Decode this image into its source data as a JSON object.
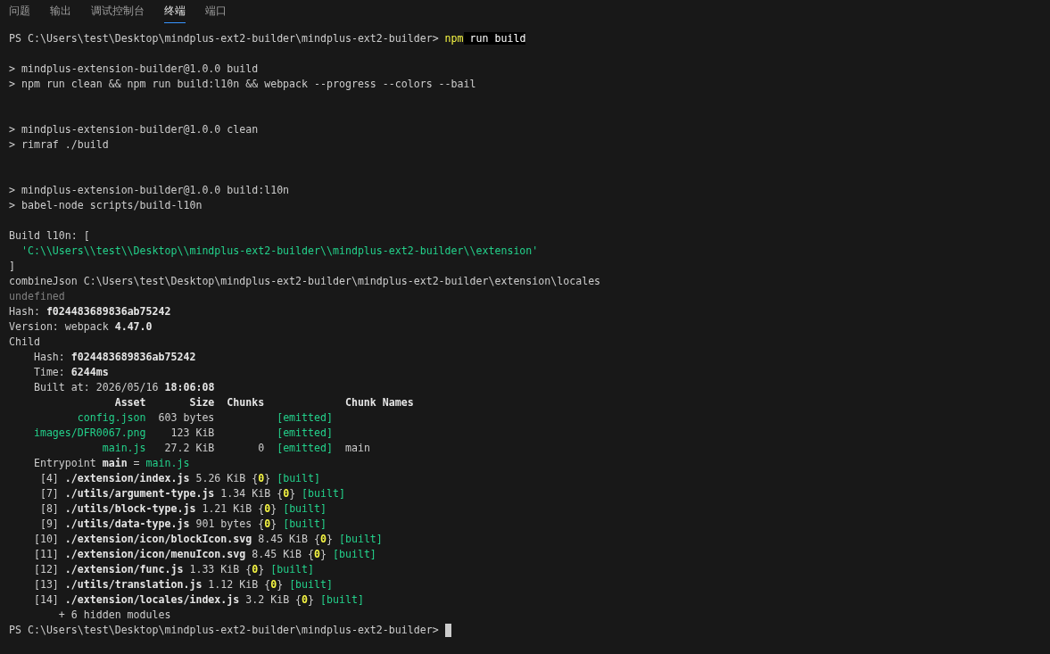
{
  "panel_tabs": [
    {
      "label": "问题",
      "selected": false
    },
    {
      "label": "输出",
      "selected": false
    },
    {
      "label": "调试控制台",
      "selected": false
    },
    {
      "label": "终端",
      "selected": true
    },
    {
      "label": "端口",
      "selected": false
    }
  ],
  "terminal_lines": [
    {
      "kind": "text",
      "segments": [
        {
          "kind": "plain",
          "text": "PS C:\\Users\\test\\Desktop\\mindplus-ext2-builder\\mindplus-ext2-builder> "
        },
        {
          "kind": "command",
          "text": "npm"
        },
        {
          "kind": "highlight",
          "text": " run build"
        }
      ]
    },
    {
      "kind": "blank"
    },
    {
      "kind": "text",
      "segments": [
        {
          "kind": "plain",
          "text": "> mindplus-extension-builder@1.0.0 build"
        }
      ]
    },
    {
      "kind": "text",
      "segments": [
        {
          "kind": "plain",
          "text": "> npm run clean && npm run build:l10n && webpack --progress --colors --bail"
        }
      ]
    },
    {
      "kind": "blank"
    },
    {
      "kind": "blank"
    },
    {
      "kind": "text",
      "segments": [
        {
          "kind": "plain",
          "text": "> mindplus-extension-builder@1.0.0 clean"
        }
      ]
    },
    {
      "kind": "text",
      "segments": [
        {
          "kind": "plain",
          "text": "> rimraf ./build"
        }
      ]
    },
    {
      "kind": "blank"
    },
    {
      "kind": "blank"
    },
    {
      "kind": "text",
      "segments": [
        {
          "kind": "plain",
          "text": "> mindplus-extension-builder@1.0.0 build:l10n"
        }
      ]
    },
    {
      "kind": "text",
      "segments": [
        {
          "kind": "plain",
          "text": "> babel-node scripts/build-l10n"
        }
      ]
    },
    {
      "kind": "blank"
    },
    {
      "kind": "text",
      "segments": [
        {
          "kind": "plain",
          "text": "Build l10n: ["
        }
      ]
    },
    {
      "kind": "text",
      "segments": [
        {
          "kind": "green",
          "text": "  'C:\\\\Users\\\\test\\\\Desktop\\\\mindplus-ext2-builder\\\\mindplus-ext2-builder\\\\extension'"
        }
      ]
    },
    {
      "kind": "text",
      "segments": [
        {
          "kind": "plain",
          "text": "]"
        }
      ]
    },
    {
      "kind": "text",
      "segments": [
        {
          "kind": "plain",
          "text": "combineJson C:\\Users\\test\\Desktop\\mindplus-ext2-builder\\mindplus-ext2-builder\\extension\\locales"
        }
      ]
    },
    {
      "kind": "text",
      "segments": [
        {
          "kind": "dim",
          "text": "undefined"
        }
      ]
    },
    {
      "kind": "text",
      "segments": [
        {
          "kind": "plain",
          "text": "Hash: "
        },
        {
          "kind": "bold",
          "text": "f024483689836ab75242"
        }
      ]
    },
    {
      "kind": "text",
      "segments": [
        {
          "kind": "plain",
          "text": "Version: webpack "
        },
        {
          "kind": "bold",
          "text": "4.47.0"
        }
      ]
    },
    {
      "kind": "text",
      "segments": [
        {
          "kind": "plain",
          "text": "Child"
        }
      ]
    },
    {
      "kind": "text",
      "segments": [
        {
          "kind": "plain",
          "text": "    Hash: "
        },
        {
          "kind": "bold",
          "text": "f024483689836ab75242"
        }
      ]
    },
    {
      "kind": "text",
      "segments": [
        {
          "kind": "plain",
          "text": "    Time: "
        },
        {
          "kind": "bold",
          "text": "6244ms"
        }
      ]
    },
    {
      "kind": "text",
      "segments": [
        {
          "kind": "plain",
          "text": "    Built at: 2026/05/16 "
        },
        {
          "kind": "bold",
          "text": "18:06:08"
        }
      ]
    },
    {
      "kind": "text",
      "segments": [
        {
          "kind": "bold",
          "text": "                 Asset       Size  Chunks             Chunk Names"
        }
      ]
    },
    {
      "kind": "text",
      "segments": [
        {
          "kind": "green",
          "text": "           config.json"
        },
        {
          "kind": "plain",
          "text": "  603 bytes          "
        },
        {
          "kind": "green",
          "text": "[emitted]"
        }
      ]
    },
    {
      "kind": "text",
      "segments": [
        {
          "kind": "green",
          "text": "    images/DFR0067.png"
        },
        {
          "kind": "plain",
          "text": "    123 KiB          "
        },
        {
          "kind": "green",
          "text": "[emitted]"
        }
      ]
    },
    {
      "kind": "text",
      "segments": [
        {
          "kind": "green",
          "text": "               main.js"
        },
        {
          "kind": "plain",
          "text": "   27.2 KiB       0  "
        },
        {
          "kind": "green",
          "text": "[emitted]"
        },
        {
          "kind": "plain",
          "text": "  main"
        }
      ]
    },
    {
      "kind": "text",
      "segments": [
        {
          "kind": "plain",
          "text": "    Entrypoint "
        },
        {
          "kind": "bold",
          "text": "main"
        },
        {
          "kind": "plain",
          "text": " = "
        },
        {
          "kind": "green",
          "text": "main.js"
        }
      ]
    },
    {
      "kind": "text",
      "segments": [
        {
          "kind": "plain",
          "text": "     [4] "
        },
        {
          "kind": "bold",
          "text": "./extension/index.js"
        },
        {
          "kind": "plain",
          "text": " 5.26 KiB {"
        },
        {
          "kind": "yellow",
          "text": "0"
        },
        {
          "kind": "plain",
          "text": "} "
        },
        {
          "kind": "green",
          "text": "[built]"
        }
      ]
    },
    {
      "kind": "text",
      "segments": [
        {
          "kind": "plain",
          "text": "     [7] "
        },
        {
          "kind": "bold",
          "text": "./utils/argument-type.js"
        },
        {
          "kind": "plain",
          "text": " 1.34 KiB {"
        },
        {
          "kind": "yellow",
          "text": "0"
        },
        {
          "kind": "plain",
          "text": "} "
        },
        {
          "kind": "green",
          "text": "[built]"
        }
      ]
    },
    {
      "kind": "text",
      "segments": [
        {
          "kind": "plain",
          "text": "     [8] "
        },
        {
          "kind": "bold",
          "text": "./utils/block-type.js"
        },
        {
          "kind": "plain",
          "text": " 1.21 KiB {"
        },
        {
          "kind": "yellow",
          "text": "0"
        },
        {
          "kind": "plain",
          "text": "} "
        },
        {
          "kind": "green",
          "text": "[built]"
        }
      ]
    },
    {
      "kind": "text",
      "segments": [
        {
          "kind": "plain",
          "text": "     [9] "
        },
        {
          "kind": "bold",
          "text": "./utils/data-type.js"
        },
        {
          "kind": "plain",
          "text": " 901 bytes {"
        },
        {
          "kind": "yellow",
          "text": "0"
        },
        {
          "kind": "plain",
          "text": "} "
        },
        {
          "kind": "green",
          "text": "[built]"
        }
      ]
    },
    {
      "kind": "text",
      "segments": [
        {
          "kind": "plain",
          "text": "    [10] "
        },
        {
          "kind": "bold",
          "text": "./extension/icon/blockIcon.svg"
        },
        {
          "kind": "plain",
          "text": " 8.45 KiB {"
        },
        {
          "kind": "yellow",
          "text": "0"
        },
        {
          "kind": "plain",
          "text": "} "
        },
        {
          "kind": "green",
          "text": "[built]"
        }
      ]
    },
    {
      "kind": "text",
      "segments": [
        {
          "kind": "plain",
          "text": "    [11] "
        },
        {
          "kind": "bold",
          "text": "./extension/icon/menuIcon.svg"
        },
        {
          "kind": "plain",
          "text": " 8.45 KiB {"
        },
        {
          "kind": "yellow",
          "text": "0"
        },
        {
          "kind": "plain",
          "text": "} "
        },
        {
          "kind": "green",
          "text": "[built]"
        }
      ]
    },
    {
      "kind": "text",
      "segments": [
        {
          "kind": "plain",
          "text": "    [12] "
        },
        {
          "kind": "bold",
          "text": "./extension/func.js"
        },
        {
          "kind": "plain",
          "text": " 1.33 KiB {"
        },
        {
          "kind": "yellow",
          "text": "0"
        },
        {
          "kind": "plain",
          "text": "} "
        },
        {
          "kind": "green",
          "text": "[built]"
        }
      ]
    },
    {
      "kind": "text",
      "segments": [
        {
          "kind": "plain",
          "text": "    [13] "
        },
        {
          "kind": "bold",
          "text": "./utils/translation.js"
        },
        {
          "kind": "plain",
          "text": " 1.12 KiB {"
        },
        {
          "kind": "yellow",
          "text": "0"
        },
        {
          "kind": "plain",
          "text": "} "
        },
        {
          "kind": "green",
          "text": "[built]"
        }
      ]
    },
    {
      "kind": "text",
      "segments": [
        {
          "kind": "plain",
          "text": "    [14] "
        },
        {
          "kind": "bold",
          "text": "./extension/locales/index.js"
        },
        {
          "kind": "plain",
          "text": " 3.2 KiB {"
        },
        {
          "kind": "yellow",
          "text": "0"
        },
        {
          "kind": "plain",
          "text": "} "
        },
        {
          "kind": "green",
          "text": "[built]"
        }
      ]
    },
    {
      "kind": "text",
      "segments": [
        {
          "kind": "plain",
          "text": "        + 6 hidden modules"
        }
      ]
    },
    {
      "kind": "text",
      "segments": [
        {
          "kind": "plain",
          "text": "PS C:\\Users\\test\\Desktop\\mindplus-ext2-builder\\mindplus-ext2-builder> "
        }
      ],
      "cursor": true
    }
  ]
}
